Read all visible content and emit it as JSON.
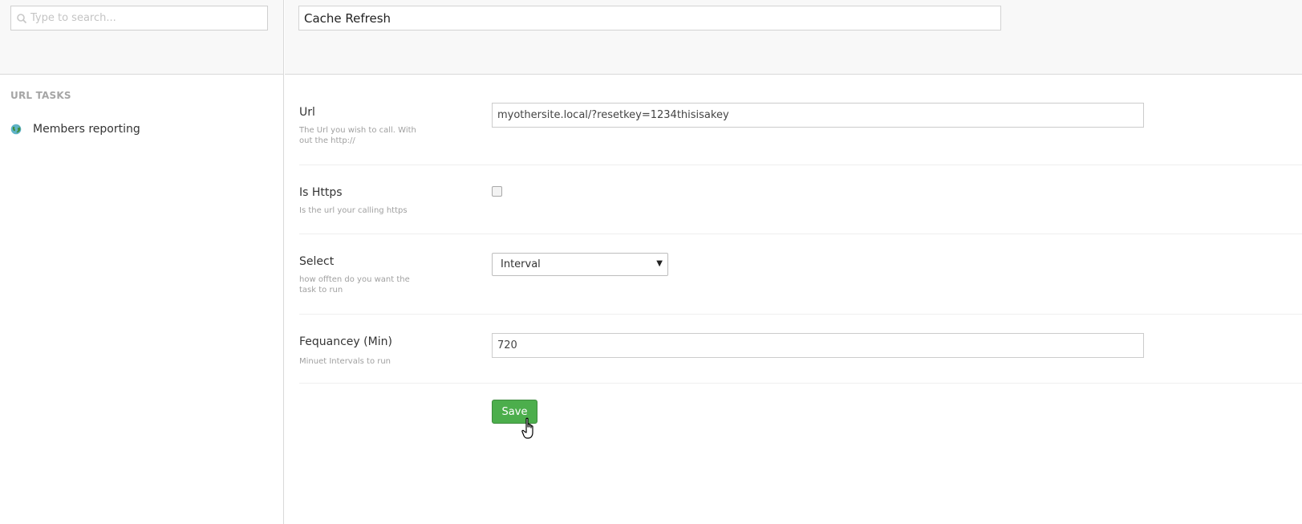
{
  "search": {
    "placeholder": "Type to search..."
  },
  "tree": {
    "section_title": "URL TASKS",
    "items": [
      {
        "label": "Members reporting",
        "icon": "globe-icon"
      }
    ]
  },
  "editor": {
    "name_value": "Cache Refresh"
  },
  "properties": {
    "url": {
      "label": "Url",
      "description": "The Url you wish to call. With out the http://",
      "value": "myothersite.local/?resetkey=1234thisisakey"
    },
    "is_https": {
      "label": "Is Https",
      "description": "Is the url your calling https",
      "checked": false
    },
    "select": {
      "label": "Select",
      "description": "how offten do you want the task to run",
      "value": "Interval"
    },
    "frequency": {
      "label": "Fequancey (Min)",
      "description": "Minuet Intervals to run",
      "value": "720"
    }
  },
  "actions": {
    "save_label": "Save"
  },
  "colors": {
    "save_button": "#4cae4c",
    "header_bg": "#f8f8f8",
    "border": "#d9d9d9",
    "muted_text": "#a0a0a0"
  }
}
